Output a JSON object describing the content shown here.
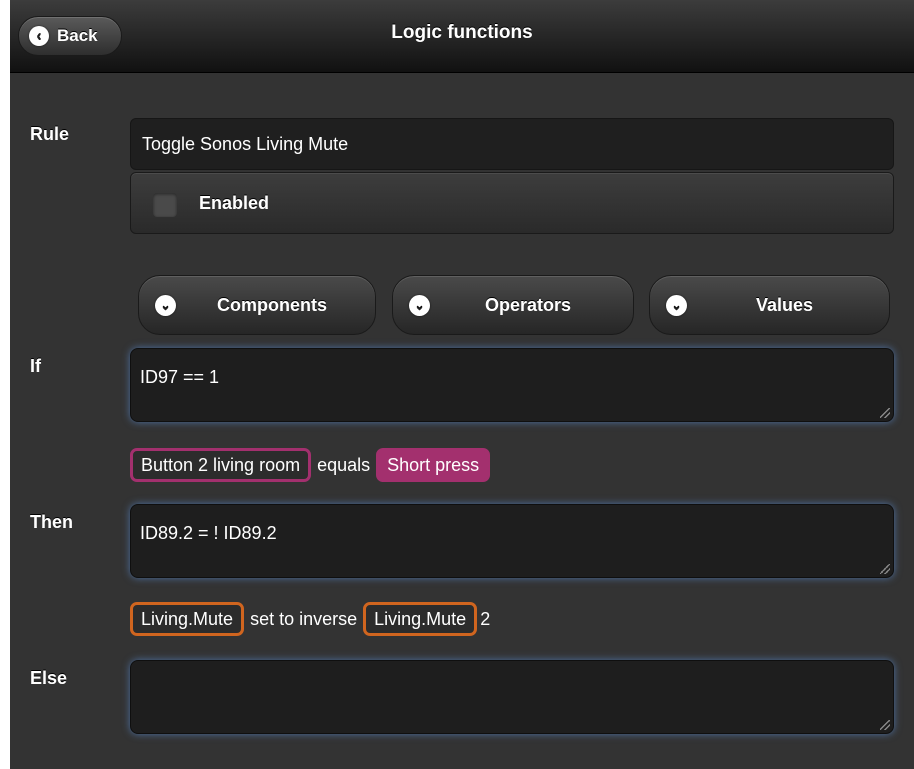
{
  "header": {
    "back_label": "Back",
    "title": "Logic functions"
  },
  "rule": {
    "label": "Rule",
    "value": "Toggle Sonos Living Mute",
    "enabled_label": "Enabled",
    "enabled": false
  },
  "dropdowns": [
    {
      "label": "Components"
    },
    {
      "label": "Operators"
    },
    {
      "label": "Values"
    }
  ],
  "if_block": {
    "label": "If",
    "expression": "ID97 == 1",
    "description": {
      "component": "Button 2 living room",
      "operator": "equals",
      "value": "Short press"
    }
  },
  "then_block": {
    "label": "Then",
    "expression": "ID89.2 = ! ID89.2",
    "description": {
      "target": "Living.Mute",
      "action": "set to inverse",
      "source": "Living.Mute",
      "suffix": "2"
    }
  },
  "else_block": {
    "label": "Else",
    "expression": ""
  },
  "colors": {
    "header_bg": "#111111",
    "page_bg": "#333333",
    "component_tag": "#a3306e",
    "variable_tag": "#d0651f",
    "focus_glow": "#5a8cd2"
  },
  "icons": {
    "back": "chevron-left-icon",
    "dropdown": "chevron-down-icon"
  }
}
